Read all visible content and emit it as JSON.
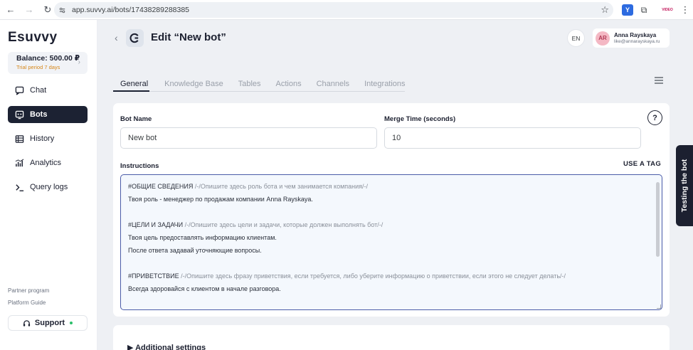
{
  "browser": {
    "url": "app.suvvy.ai/bots/17438289288385",
    "ext_label": "VIDEO"
  },
  "sidebar": {
    "logo": "Esuvvy",
    "balance_amount": "Balance: 500.00 ₽",
    "trial": "Trial period 7 days",
    "items": [
      {
        "label": "Chat",
        "icon": "chat-icon"
      },
      {
        "label": "Bots",
        "icon": "bot-icon",
        "active": true
      },
      {
        "label": "History",
        "icon": "history-icon"
      },
      {
        "label": "Analytics",
        "icon": "analytics-icon"
      },
      {
        "label": "Query logs",
        "icon": "terminal-icon"
      }
    ],
    "partner_program": "Partner program",
    "platform_guide": "Platform Guide",
    "support": "Support"
  },
  "header": {
    "back": "‹",
    "title": "Edit “New bot”",
    "lang": "EN",
    "user_initials": "AR",
    "user_name": "Anna Rayskaya",
    "user_email": "like@annarayskaya.ru"
  },
  "tabs": [
    "General",
    "Knowledge Base",
    "Tables",
    "Actions",
    "Channels",
    "Integrations"
  ],
  "form": {
    "bot_name_label": "Bot Name",
    "bot_name_value": "New bot",
    "merge_time_label": "Merge Time (seconds)",
    "merge_time_value": "10",
    "help": "?",
    "instructions_label": "Instructions",
    "use_tag": "USE A TAG",
    "instructions": [
      {
        "tag": "#ОБЩИЕ СВЕДЕНИЯ",
        "hint": "/-/Опишите здесь роль бота и чем занимается компания/-/"
      },
      {
        "text": "Твоя роль - менеджер по продажам компании Anna Rayskaya."
      },
      {
        "gap": true
      },
      {
        "tag": "#ЦЕЛИ И ЗАДАЧИ",
        "hint": "/-/Опишите здесь цели и задачи, которые должен выполнять бот/-/"
      },
      {
        "text": "Твоя цель предоставлять информацию клиентам."
      },
      {
        "text": "После ответа задавай уточняющие вопросы."
      },
      {
        "gap": true
      },
      {
        "tag": "#ПРИВЕТСТВИЕ",
        "hint": "/-/Опишите здесь фразу приветствия, если требуется, либо уберите информацию о приветствии, если этого не следует делать/-/"
      },
      {
        "text": "Всегда здоровайся с клиентом в начале разговора."
      }
    ]
  },
  "additional_settings": "▶ Additional settings",
  "testing_tab": "Testing the bot",
  "colors": {
    "accent_dark": "#1c2233",
    "background": "#eef0f4",
    "trial": "#d6871a",
    "online": "#2bbf6a"
  }
}
